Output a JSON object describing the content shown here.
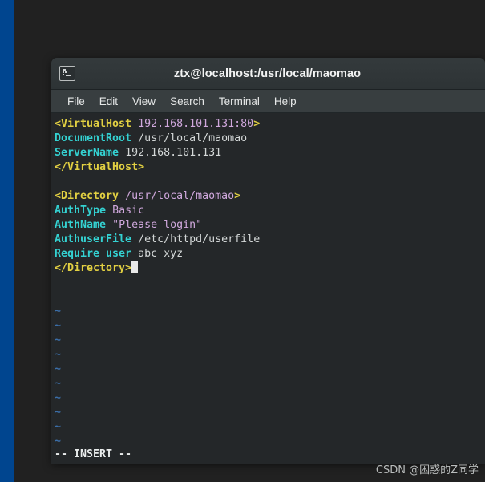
{
  "desktop": {
    "background_color": "#212121",
    "accent_strip_color": "#00458f"
  },
  "window": {
    "title": "ztx@localhost:/usr/local/maomao",
    "icon": "terminal-icon",
    "titlebar_color": "#343a3c",
    "menubar_color": "#383e40",
    "terminal_background": "#242729"
  },
  "menu": {
    "items": [
      {
        "label": "File"
      },
      {
        "label": "Edit"
      },
      {
        "label": "View"
      },
      {
        "label": "Search"
      },
      {
        "label": "Terminal"
      },
      {
        "label": "Help"
      }
    ]
  },
  "editor": {
    "mode_status": "-- INSERT --",
    "tilde_symbol": "~",
    "tilde_count": 10,
    "colors": {
      "tag": "#e2d042",
      "directive": "#34d2d2",
      "value": "#d0a8dd",
      "plain": "#d4d8d8",
      "tilde": "#3b6ea8",
      "cursor": "#e8e8e8"
    },
    "lines": [
      {
        "tag_open": "<VirtualHost",
        "value": "192.168.101.131:80",
        "tag_close": ">"
      },
      {
        "directive": "DocumentRoot",
        "plain": "/usr/local/maomao"
      },
      {
        "directive": "ServerName",
        "plain": "192.168.101.131"
      },
      {
        "tag_open": "</VirtualHost>"
      },
      {
        "blank": true
      },
      {
        "tag_open": "<Directory",
        "value": "/usr/local/maomao",
        "tag_close": ">"
      },
      {
        "directive": "AuthType",
        "value": "Basic"
      },
      {
        "directive": "AuthName",
        "value": "\"Please login\""
      },
      {
        "directive": "AuthuserFile",
        "plain": "/etc/httpd/userfile"
      },
      {
        "directive": "Require user",
        "plain": "abc xyz"
      },
      {
        "tag_open": "</Directory>",
        "cursor": true
      }
    ]
  },
  "watermark": {
    "text": "CSDN @困惑的Z同学"
  }
}
